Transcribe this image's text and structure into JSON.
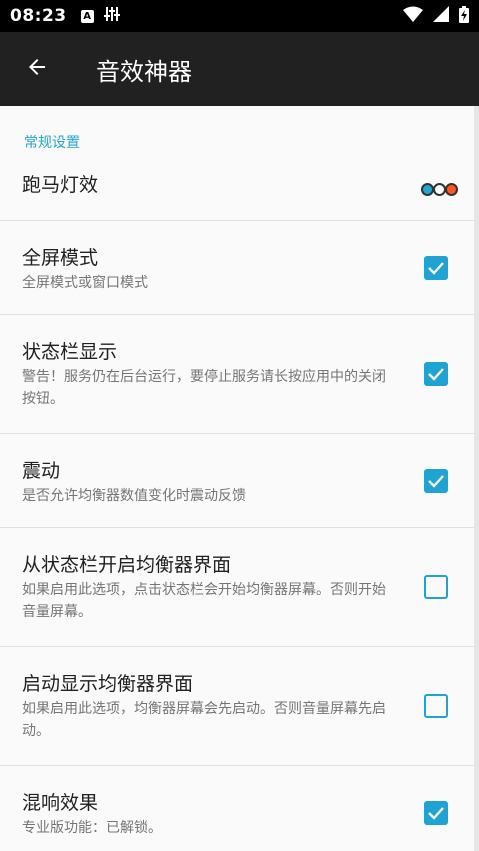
{
  "status_bar": {
    "time": "08:23",
    "left_icons": [
      "a-letter-icon",
      "equalizer-icon"
    ],
    "right_icons": [
      "wifi-icon",
      "signal-icon",
      "battery-icon"
    ]
  },
  "app_bar": {
    "back_icon": "arrow-left-icon",
    "title": "音效神器"
  },
  "section": {
    "label": "常规设置"
  },
  "prefs": [
    {
      "title": "跑马灯效",
      "summary": "",
      "control": "color-dots",
      "dot_colors": [
        "#23a7d2",
        "#ffffff",
        "#ff5722"
      ]
    },
    {
      "title": "全屏模式",
      "summary": "全屏模式或窗口模式",
      "control": "checkbox",
      "checked": true
    },
    {
      "title": "状态栏显示",
      "summary": "警告！服务仍在后台运行，要停止服务请长按应用中的关闭按钮。",
      "control": "checkbox",
      "checked": true
    },
    {
      "title": "震动",
      "summary": "是否允许均衡器数值变化时震动反馈",
      "control": "checkbox",
      "checked": true
    },
    {
      "title": "从状态栏开启均衡器界面",
      "summary": "如果启用此选项，点击状态栏会开始均衡器屏幕。否则开始音量屏幕。",
      "control": "checkbox",
      "checked": false
    },
    {
      "title": "启动显示均衡器界面",
      "summary": "如果启用此选项，均衡器屏幕会先启动。否则音量屏幕先启动。",
      "control": "checkbox",
      "checked": false
    },
    {
      "title": "混响效果",
      "summary": "专业版功能：已解锁。",
      "control": "checkbox",
      "checked": true
    }
  ],
  "colors": {
    "accent": "#1ea3d2",
    "app_bar": "#212121",
    "background": "#fafafa"
  }
}
